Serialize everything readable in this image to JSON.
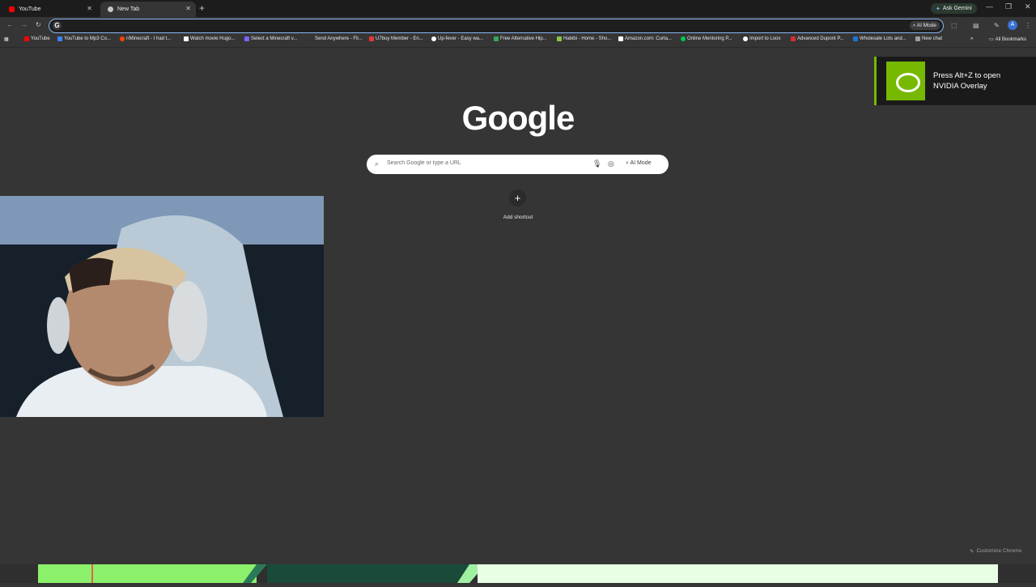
{
  "tabs": [
    {
      "label": "YouTube",
      "color": "#ff0000"
    },
    {
      "label": "New Tab",
      "color": "#c4c7c5"
    }
  ],
  "gemini_label": "Ask Gemini",
  "omnibox": {
    "value": "",
    "ai_mode_label": "AI Mode"
  },
  "profile_initial": "A",
  "bookmarks": [
    {
      "label": "YouTube",
      "color": "#ff0000"
    },
    {
      "label": "YouTube to Mp3 Co...",
      "color": "#3b82f6"
    },
    {
      "label": "r/Minecraft - I had t...",
      "color": "#ff4500"
    },
    {
      "label": "Watch movie Hugo...",
      "color": "#ffffff"
    },
    {
      "label": "Select a Minecraft v...",
      "color": "#7b61ff"
    },
    {
      "label": "Send Anywhere - Fil...",
      "color": "#333333"
    },
    {
      "label": "U7buy Member - En...",
      "color": "#e53935"
    },
    {
      "label": "Up-fever - Easy wa...",
      "color": "#ffffff"
    },
    {
      "label": "Free Alternative Hip...",
      "color": "#34a853"
    },
    {
      "label": "Habibi - Home - Sho...",
      "color": "#8bc34a"
    },
    {
      "label": "Amazon.com: Curta...",
      "color": "#ffffff"
    },
    {
      "label": "Online Mentoring P...",
      "color": "#00c853"
    },
    {
      "label": "Import to Loox",
      "color": "#ffffff"
    },
    {
      "label": "Advanced Dupont P...",
      "color": "#d32f2f"
    },
    {
      "label": "Wholesale Lots and...",
      "color": "#1976d2"
    },
    {
      "label": "New chat",
      "color": "#9e9e9e"
    }
  ],
  "all_bookmarks_label": "All Bookmarks",
  "ntp": {
    "logo": "Google",
    "search_placeholder": "Search Google or type a URL",
    "ai_mode_label": "AI Mode",
    "add_shortcut_label": "Add shortcut",
    "customize_label": "Customize Chrome"
  },
  "nvidia": {
    "line1": "Press Alt+Z to open",
    "line2": "NVIDIA Overlay",
    "accent": "#76b900"
  }
}
